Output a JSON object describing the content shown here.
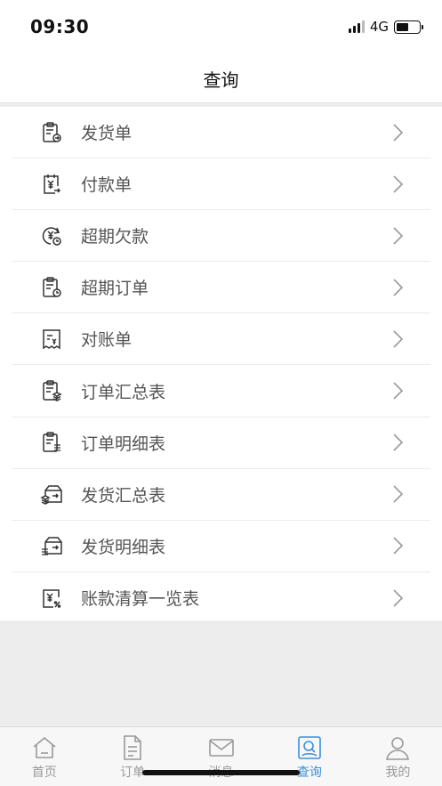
{
  "status_bar": {
    "time": "09:30",
    "network": "4G",
    "battery_level": 0.55
  },
  "nav": {
    "title": "查询"
  },
  "menu": [
    {
      "label": "发货单",
      "icon": "clipboard-arrow-icon"
    },
    {
      "label": "付款单",
      "icon": "yen-payment-icon"
    },
    {
      "label": "超期欠款",
      "icon": "yen-clock-icon"
    },
    {
      "label": "超期订单",
      "icon": "clipboard-clock-icon"
    },
    {
      "label": "对账单",
      "icon": "receipt-yen-icon"
    },
    {
      "label": "订单汇总表",
      "icon": "clipboard-stack-icon"
    },
    {
      "label": "订单明细表",
      "icon": "clipboard-list-icon"
    },
    {
      "label": "发货汇总表",
      "icon": "box-stack-icon"
    },
    {
      "label": "发货明细表",
      "icon": "box-list-icon"
    },
    {
      "label": "账款清算一览表",
      "icon": "yen-percent-icon"
    }
  ],
  "tabs": [
    {
      "label": "首页",
      "icon": "home-icon",
      "active": false
    },
    {
      "label": "订单",
      "icon": "document-icon",
      "active": false
    },
    {
      "label": "消息",
      "icon": "envelope-icon",
      "active": false
    },
    {
      "label": "查询",
      "icon": "search-person-icon",
      "active": true
    },
    {
      "label": "我的",
      "icon": "user-icon",
      "active": false
    }
  ],
  "colors": {
    "accent": "#3d8fdc",
    "icon": "#333333",
    "inactive": "#999999"
  }
}
